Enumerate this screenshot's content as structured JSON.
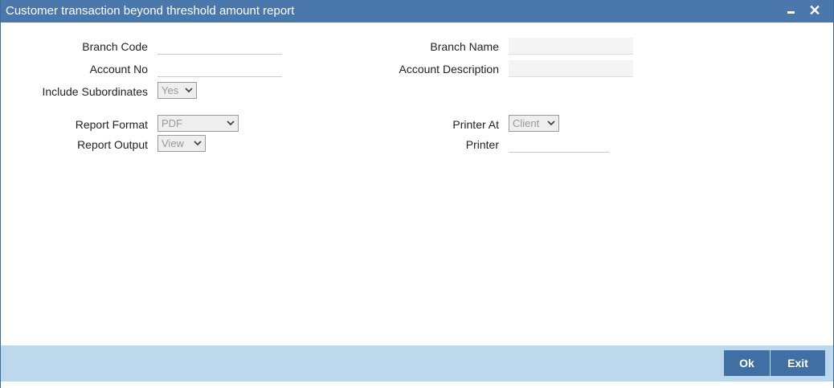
{
  "window": {
    "title": "Customer transaction beyond threshold amount report",
    "minimize_icon": "minimize-icon",
    "close_icon": "close-icon"
  },
  "form": {
    "branch_code": {
      "label": "Branch Code",
      "value": ""
    },
    "branch_name": {
      "label": "Branch Name",
      "value": ""
    },
    "account_no": {
      "label": "Account No",
      "value": ""
    },
    "account_description": {
      "label": "Account Description",
      "value": ""
    },
    "include_subordinates": {
      "label": "Include Subordinates",
      "value": "Yes"
    },
    "report_format": {
      "label": "Report Format",
      "value": "PDF"
    },
    "report_output": {
      "label": "Report Output",
      "value": "View"
    },
    "printer_at": {
      "label": "Printer At",
      "value": "Client"
    },
    "printer": {
      "label": "Printer",
      "value": ""
    }
  },
  "footer": {
    "ok_label": "Ok",
    "exit_label": "Exit"
  }
}
